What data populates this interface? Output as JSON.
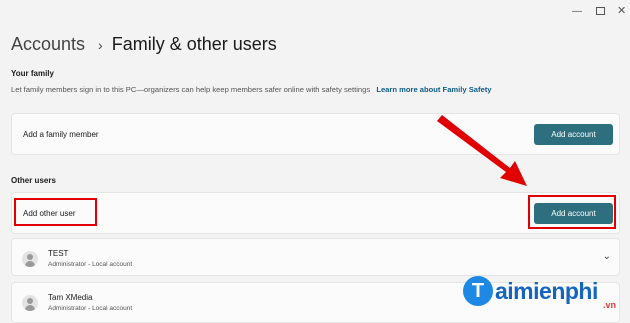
{
  "window": {
    "minimize_icon": "minimize-icon",
    "maximize_icon": "maximize-icon",
    "close_icon": "close-icon"
  },
  "breadcrumb": {
    "parent": "Accounts",
    "separator": "›",
    "current": "Family & other users"
  },
  "your_family": {
    "title": "Your family",
    "description": "Let family members sign in to this PC—organizers can help keep members safer online with safety settings",
    "link": "Learn more about Family Safety",
    "row_label": "Add a family member",
    "button": "Add account"
  },
  "other_users": {
    "title": "Other users",
    "row_label": "Add other user",
    "button": "Add account",
    "users": [
      {
        "name": "TEST",
        "role": "Administrator - Local account"
      },
      {
        "name": "Tam XMedia",
        "role": "Administrator - Local account"
      }
    ]
  },
  "annotations": {
    "color": "#e00000"
  },
  "watermark": {
    "logo_letter": "T",
    "text": "aimienphi",
    "suffix": ".vn"
  }
}
